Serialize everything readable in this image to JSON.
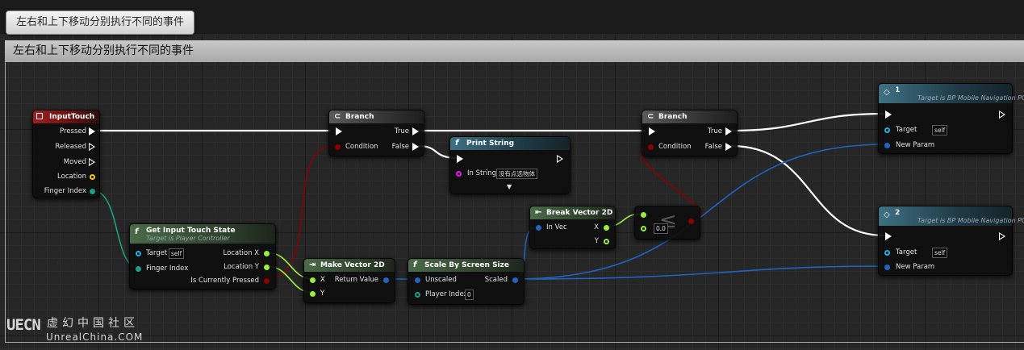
{
  "tooltip_text": "左右和上下移动分别执行不同的事件",
  "comment": {
    "title": "左右和上下移动分别执行不同的事件"
  },
  "nodes": {
    "input_touch": {
      "title": "InputTouch",
      "pins": [
        "Pressed",
        "Released",
        "Moved",
        "Location",
        "Finger Index"
      ]
    },
    "branch1": {
      "title": "Branch",
      "condition": "Condition",
      "true": "True",
      "false": "False"
    },
    "print_string": {
      "title": "Print String",
      "in_string": "In String",
      "in_string_value": "没有点选物体"
    },
    "branch2": {
      "title": "Branch",
      "condition": "Condition",
      "true": "True",
      "false": "False"
    },
    "custom1": {
      "title": "1",
      "subtitle": "Target is BP Mobile Navigation PC",
      "target": "Target",
      "target_value": "self",
      "new_param": "New Param"
    },
    "custom2": {
      "title": "2",
      "subtitle": "Target is BP Mobile Navigation PC",
      "target": "Target",
      "target_value": "self",
      "new_param": "New Param"
    },
    "get_touch_state": {
      "title": "Get Input Touch State",
      "subtitle": "Target is Player Controller",
      "target": "Target",
      "target_value": "self",
      "finger_index": "Finger Index",
      "location_x": "Location X",
      "location_y": "Location Y",
      "is_pressed": "Is Currently Pressed"
    },
    "make_vector": {
      "title": "Make Vector 2D",
      "x": "X",
      "y": "Y",
      "return_value": "Return Value"
    },
    "scale_screen": {
      "title": "Scale By Screen Size",
      "unscaled": "Unscaled",
      "scaled": "Scaled",
      "player_index": "Player Index",
      "player_index_value": "0"
    },
    "break_vector": {
      "title": "Break Vector 2D",
      "in_vec": "In Vec",
      "x": "X",
      "y": "Y"
    },
    "compare": {
      "value": "0.0"
    }
  },
  "watermark": {
    "logo": "UECN",
    "cn": "虚幻中国社区",
    "en": "UnrealChina.COM"
  },
  "colors": {
    "exec": "#ffffff",
    "bool": "#8c0000",
    "float": "#9bef3c",
    "vector2d": "#2164bf",
    "int": "#1e9e84",
    "object": "#1cb0e5",
    "string": "#f20ff2",
    "struct": "#f7c50b"
  }
}
